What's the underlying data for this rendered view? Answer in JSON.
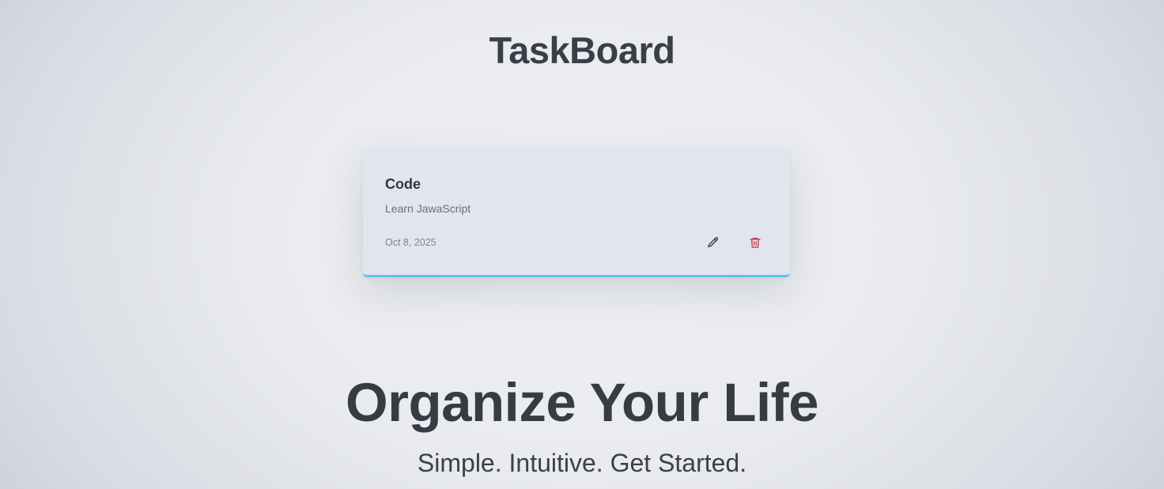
{
  "app": {
    "title": "TaskBoard"
  },
  "task_card": {
    "title": "Code",
    "description": "Learn JawaScript",
    "date": "Oct 8, 2025",
    "accent_color": "#5cc3ea",
    "edit_icon": "pencil-icon",
    "delete_icon": "trash-icon",
    "delete_color": "#c9485a"
  },
  "hero": {
    "title": "Organize Your Life",
    "subtitle": "Simple. Intuitive. Get Started."
  }
}
